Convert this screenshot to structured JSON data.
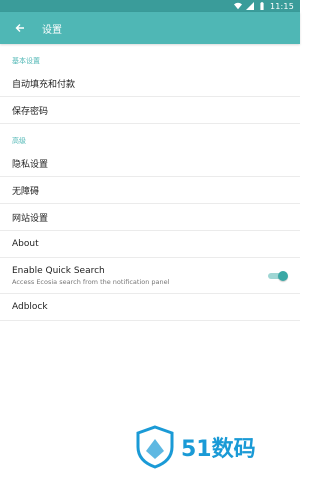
{
  "status_bar": {
    "time": "11:15"
  },
  "app_bar": {
    "title": "设置"
  },
  "sections": [
    {
      "header": "基本设置",
      "items": [
        "自动填充和付款",
        "保存密码"
      ]
    },
    {
      "header": "高级",
      "items": [
        "隐私设置",
        "无障碍",
        "网站设置",
        "About"
      ]
    }
  ],
  "quick_search": {
    "title": "Enable Quick Search",
    "summary": "Access Ecosia search from the notification panel",
    "enabled": true
  },
  "adblock": {
    "label": "Adblock"
  },
  "watermark": {
    "text": "51数码"
  },
  "colors": {
    "accent": "#4fb7b5",
    "status_bar": "#3a9c9a",
    "toggle_thumb": "#3aa8a5"
  }
}
